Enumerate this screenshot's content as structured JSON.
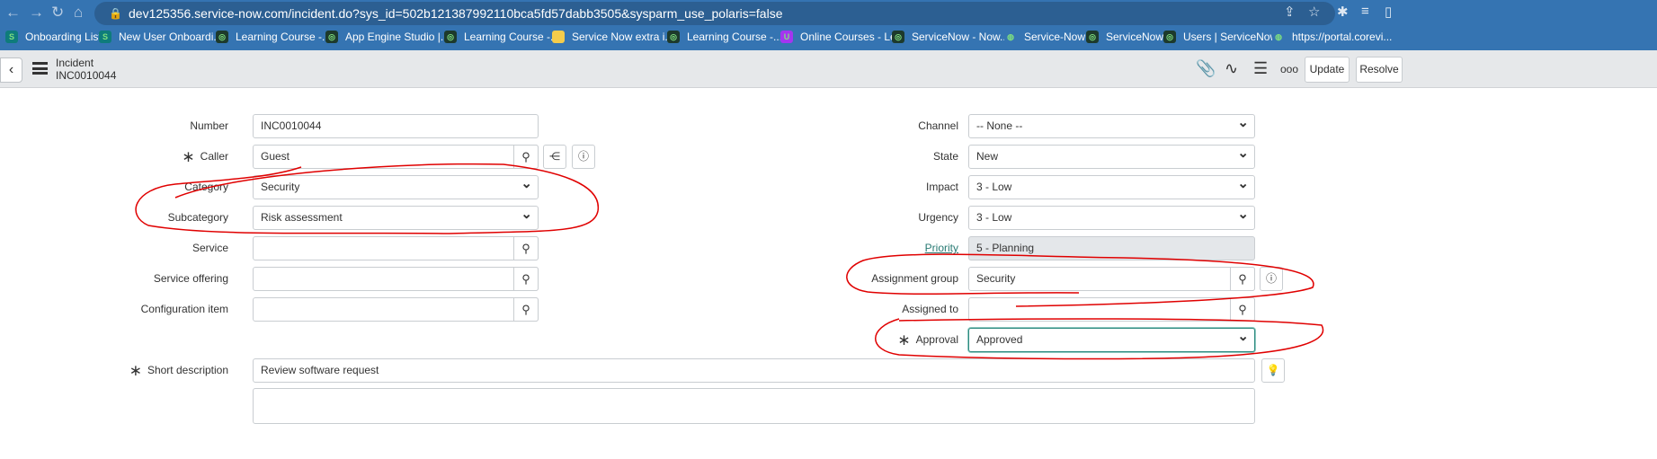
{
  "browser": {
    "url": "dev125356.service-now.com/incident.do?sys_id=502b121387992110bca5fd57dabb3505&sysparm_use_polaris=false",
    "bookmarks": [
      {
        "label": "Onboarding List",
        "icon": "sharepoint-icon"
      },
      {
        "label": "New User Onboardi...",
        "icon": "sharepoint-icon"
      },
      {
        "label": "Learning Course -...",
        "icon": "servicenow-icon"
      },
      {
        "label": "App Engine Studio |...",
        "icon": "servicenow-icon"
      },
      {
        "label": "Learning Course -...",
        "icon": "servicenow-icon"
      },
      {
        "label": "Service Now extra i...",
        "icon": "doc-icon"
      },
      {
        "label": "Learning Course -...",
        "icon": "servicenow-icon"
      },
      {
        "label": "Online Courses - Le...",
        "icon": "udemy-icon"
      },
      {
        "label": "ServiceNow - Now...",
        "icon": "servicenow-icon"
      },
      {
        "label": "Service-Now",
        "icon": "globe-icon"
      },
      {
        "label": "ServiceNow",
        "icon": "servicenow-icon"
      },
      {
        "label": "Users | ServiceNow",
        "icon": "servicenow-icon"
      },
      {
        "label": "https://portal.corevi...",
        "icon": "globe-icon"
      }
    ]
  },
  "header": {
    "title": "Incident",
    "number": "INC0010044",
    "update": "Update",
    "resolve": "Resolve"
  },
  "form": {
    "left": [
      {
        "label": "Number",
        "value": "INC0010044"
      },
      {
        "label": "Caller",
        "value": "Guest"
      },
      {
        "label": "Category",
        "value": "Security"
      },
      {
        "label": "Subcategory",
        "value": "Risk assessment"
      },
      {
        "label": "Service",
        "value": ""
      },
      {
        "label": "Service offering",
        "value": ""
      },
      {
        "label": "Configuration item",
        "value": ""
      }
    ],
    "right": [
      {
        "label": "Channel",
        "value": "-- None --"
      },
      {
        "label": "State",
        "value": "New"
      },
      {
        "label": "Impact",
        "value": "3 - Low"
      },
      {
        "label": "Urgency",
        "value": "3 - Low"
      },
      {
        "label": "Priority",
        "value": "5 - Planning"
      },
      {
        "label": "Assignment group",
        "value": "Security"
      },
      {
        "label": "Assigned to",
        "value": ""
      },
      {
        "label": "Approval",
        "value": "Approved"
      }
    ],
    "short_description": {
      "label": "Short description",
      "value": "Review software request"
    }
  },
  "colors": {
    "chrome": "#3574b2",
    "annotation": "#e00000",
    "link": "#287a73"
  }
}
